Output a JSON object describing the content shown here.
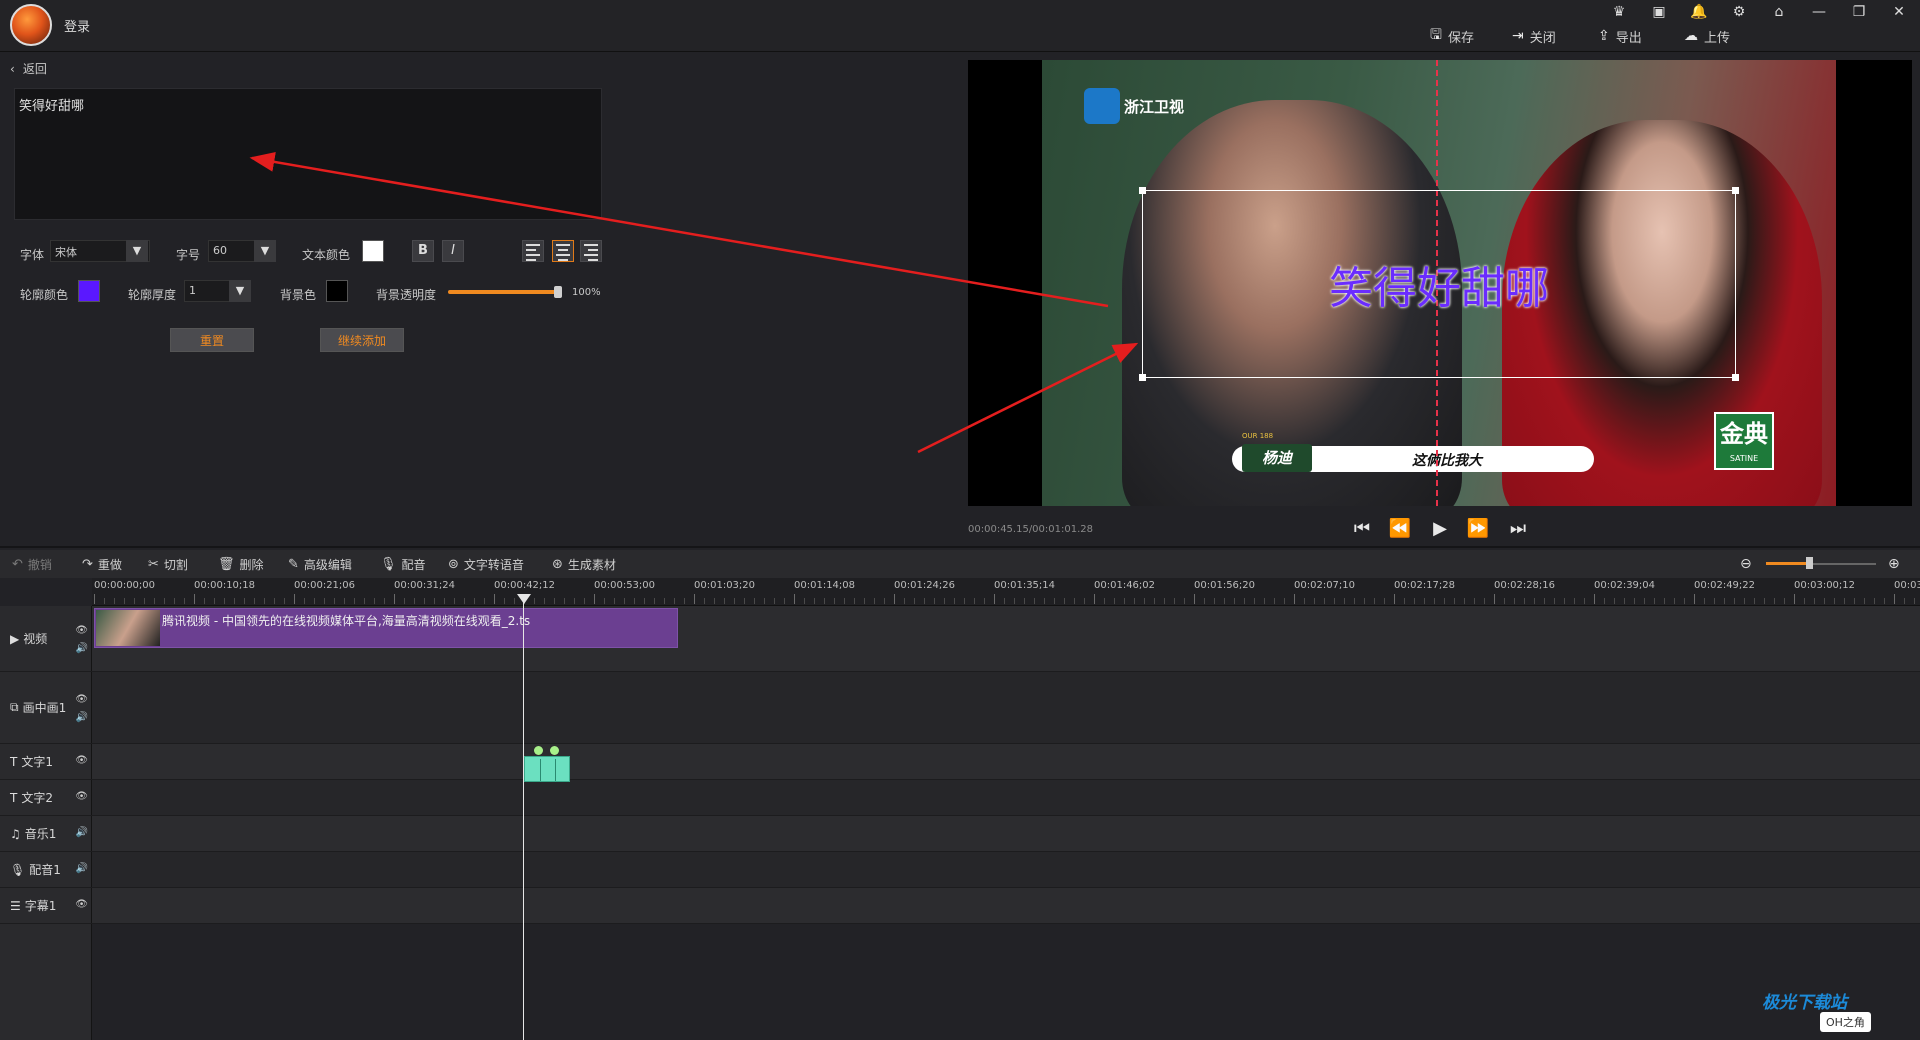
{
  "app": {
    "login_label": "登录",
    "window_controls": [
      "♛",
      "▣",
      "🔔",
      "⚙",
      "⌂",
      "—",
      "❐",
      "✕"
    ],
    "actions": {
      "save": "保存",
      "close": "关闭",
      "export": "导出",
      "upload": "上传"
    }
  },
  "editor": {
    "back_label": "返回",
    "text_value": "笑得好甜哪",
    "font_label": "字体",
    "font_value": "宋体",
    "size_label": "字号",
    "size_value": "60",
    "text_color_label": "文本颜色",
    "text_color": "#ffffff",
    "bold_label": "B",
    "italic_label": "I",
    "outline_color_label": "轮廓颜色",
    "outline_color": "#5a18ff",
    "outline_thickness_label": "轮廓厚度",
    "outline_thickness_value": "1",
    "bg_color_label": "背景色",
    "bg_color": "#000000",
    "bg_opacity_label": "背景透明度",
    "bg_opacity_value": "100%",
    "bg_opacity_level": 1.0,
    "reset_label": "重置",
    "continue_add_label": "继续添加",
    "align_active": "center"
  },
  "preview": {
    "channel_name": "浙江卫视",
    "caption": "笑得好甜哪",
    "name_tag": "杨迪",
    "name_banner_text": "这俩比我大",
    "name_tag_small": "OUR 188",
    "watermark_main": "金典",
    "watermark_sub": "SATINE",
    "timecode": "00:00:45.15/00:01:01.28"
  },
  "toolbar": {
    "undo": "撤销",
    "redo": "重做",
    "cut": "切割",
    "delete": "删除",
    "advanced": "高级编辑",
    "dub": "配音",
    "tts": "文字转语音",
    "generate": "生成素材"
  },
  "timeline": {
    "ruler_labels": [
      "00:00:00;00",
      "00:00:10;18",
      "00:00:21;06",
      "00:00:31;24",
      "00:00:42;12",
      "00:00:53;00",
      "00:01:03;20",
      "00:01:14;08",
      "00:01:24;26",
      "00:01:35;14",
      "00:01:46;02",
      "00:01:56;20",
      "00:02:07;10",
      "00:02:17;28",
      "00:02:28;16",
      "00:02:39;04",
      "00:02:49;22",
      "00:03:00;12",
      "00:03"
    ],
    "tracks": [
      {
        "name": "视频",
        "icon": "▶"
      },
      {
        "name": "画中画1",
        "icon": "⧉"
      },
      {
        "name": "文字1",
        "icon": "T"
      },
      {
        "name": "文字2",
        "icon": "T"
      },
      {
        "name": "音乐1",
        "icon": "♫"
      },
      {
        "name": "配音1",
        "icon": "🎙"
      },
      {
        "name": "字幕1",
        "icon": "☰"
      }
    ],
    "video_clip_label": "腾讯视频 - 中国领先的在线视频媒体平台,海量高清视频在线观看_2.ts"
  },
  "site": {
    "badge": "极光下载站",
    "badge_sub": "OH之角"
  }
}
